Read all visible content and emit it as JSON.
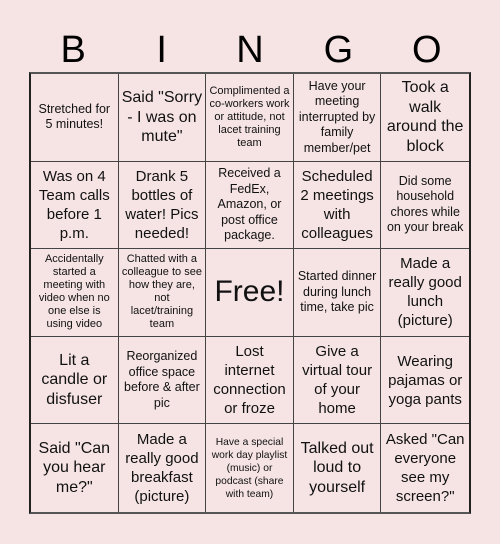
{
  "header": [
    "B",
    "I",
    "N",
    "G",
    "O"
  ],
  "cells": [
    "Stretched for 5 minutes!",
    "Said \"Sorry - I was on mute\"",
    "Complimented a co-workers work or attitude, not lacet training team",
    "Have your meeting interrupted by family member/pet",
    "Took a walk around the block",
    "Was on 4 Team calls before 1 p.m.",
    "Drank 5 bottles of water! Pics needed!",
    "Received a FedEx, Amazon, or post office package.",
    "Scheduled 2 meetings with colleagues",
    "Did some household chores while on your break",
    "Accidentally started a meeting with video when no one else is using video",
    "Chatted with a colleague to see how they are, not lacet/training team",
    "Free!",
    "Started dinner during lunch time, take pic",
    "Made a really good lunch (picture)",
    "Lit a candle or disfuser",
    "Reorganized office space before & after pic",
    "Lost internet connection or froze",
    "Give a virtual tour of your home",
    "Wearing pajamas or yoga pants",
    "Said \"Can you hear me?\"",
    "Made a really good breakfast (picture)",
    "Have a special work day playlist (music) or podcast (share with team)",
    "Talked out loud to yourself",
    "Asked \"Can everyone see my screen?\""
  ],
  "colors": {
    "background": "#f6e4e5",
    "grid_line": "#444444",
    "text": "#111111"
  }
}
